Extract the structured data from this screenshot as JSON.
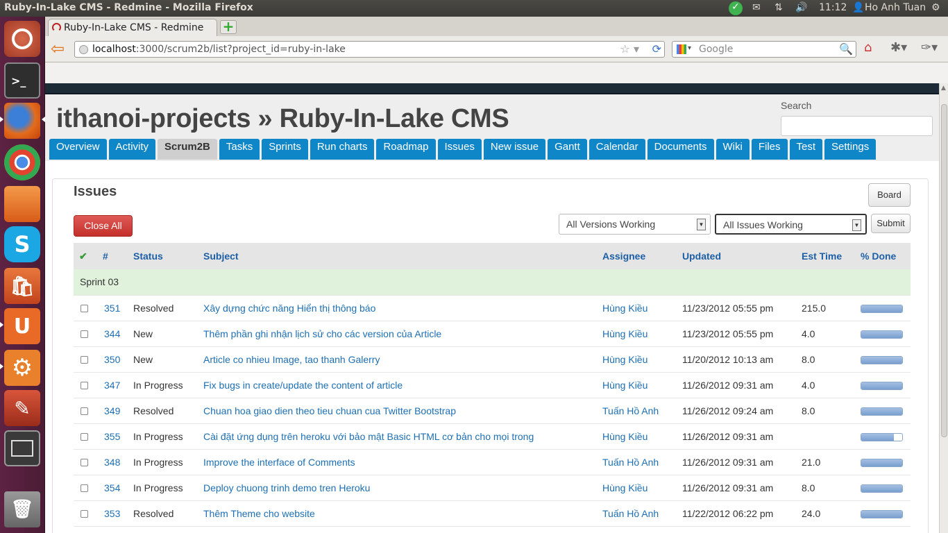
{
  "os": {
    "window_title": "Ruby-In-Lake CMS - Redmine - Mozilla Firefox",
    "clock": "11:12",
    "user": "Ho Anh Tuan"
  },
  "launcher": {
    "items": [
      "ubuntu-logo-icon",
      "terminal-icon",
      "firefox-icon",
      "chrome-icon",
      "files-icon",
      "skype-icon",
      "software-center-icon",
      "ubuntu-one-icon",
      "system-settings-icon",
      "update-manager-icon",
      "workspace-switcher-icon",
      "trash-icon"
    ]
  },
  "browser": {
    "tab_title": "Ruby-In-Lake CMS - Redmine",
    "url_host": "localhost",
    "url_rest": ":3000/scrum2b/list?project_id=ruby-in-lake",
    "search_placeholder": "Google"
  },
  "header": {
    "project_title": "ithanoi-projects » Ruby-In-Lake CMS",
    "search_label": "Search"
  },
  "menu": [
    {
      "label": "Overview"
    },
    {
      "label": "Activity"
    },
    {
      "label": "Scrum2B",
      "selected": true
    },
    {
      "label": "Tasks"
    },
    {
      "label": "Sprints"
    },
    {
      "label": "Run charts"
    },
    {
      "label": "Roadmap"
    },
    {
      "label": "Issues"
    },
    {
      "label": "New issue"
    },
    {
      "label": "Gantt"
    },
    {
      "label": "Calendar"
    },
    {
      "label": "Documents"
    },
    {
      "label": "Wiki"
    },
    {
      "label": "Files"
    },
    {
      "label": "Test"
    },
    {
      "label": "Settings"
    }
  ],
  "issues": {
    "heading": "Issues",
    "board_label": "Board",
    "close_all_label": "Close All",
    "version_filter": "All Versions Working",
    "issue_filter": "All Issues Working",
    "submit_label": "Submit",
    "columns": {
      "check": "✔",
      "id": "#",
      "status": "Status",
      "subject": "Subject",
      "assignee": "Assignee",
      "updated": "Updated",
      "est": "Est Time",
      "done": "% Done"
    },
    "group": "Sprint 03",
    "rows": [
      {
        "id": "351",
        "status": "Resolved",
        "subject": "Xây dựng chức năng Hiển thị thông báo",
        "assignee": "Hùng Kiều",
        "updated": "11/23/2012 05:55 pm",
        "est": "215.0",
        "done": 100
      },
      {
        "id": "344",
        "status": "New",
        "subject": "Thêm phần ghi nhận lịch sử cho các version của Article",
        "assignee": "Hùng Kiều",
        "updated": "11/23/2012 05:55 pm",
        "est": "4.0",
        "done": 100
      },
      {
        "id": "350",
        "status": "New",
        "subject": "Article co nhieu Image, tao thanh Galerry",
        "assignee": "Hùng Kiều",
        "updated": "11/20/2012 10:13 am",
        "est": "8.0",
        "done": 100
      },
      {
        "id": "347",
        "status": "In Progress",
        "subject": "Fix bugs in create/update the content of article",
        "assignee": "Hùng Kiều",
        "updated": "11/26/2012 09:31 am",
        "est": "4.0",
        "done": 100
      },
      {
        "id": "349",
        "status": "Resolved",
        "subject": "Chuan hoa giao dien theo tieu chuan cua Twitter Bootstrap",
        "assignee": "Tuấn Hồ Anh",
        "updated": "11/26/2012 09:24 am",
        "est": "8.0",
        "done": 100
      },
      {
        "id": "355",
        "status": "In Progress",
        "subject": "Cài đặt ứng dụng trên heroku với bảo mật Basic HTML cơ bản cho mọi trong",
        "assignee": "Hùng Kiều",
        "updated": "11/26/2012 09:31 am",
        "est": "",
        "done": 80
      },
      {
        "id": "348",
        "status": "In Progress",
        "subject": "Improve the interface of Comments",
        "assignee": "Tuấn Hồ Anh",
        "updated": "11/26/2012 09:31 am",
        "est": "21.0",
        "done": 100
      },
      {
        "id": "354",
        "status": "In Progress",
        "subject": "Deploy chuong trinh demo tren Heroku",
        "assignee": "Hùng Kiều",
        "updated": "11/26/2012 09:31 am",
        "est": "8.0",
        "done": 100
      },
      {
        "id": "353",
        "status": "Resolved",
        "subject": "Thêm Theme cho website",
        "assignee": "Tuấn Hồ Anh",
        "updated": "11/22/2012 06:22 pm",
        "est": "24.0",
        "done": 100
      }
    ]
  }
}
